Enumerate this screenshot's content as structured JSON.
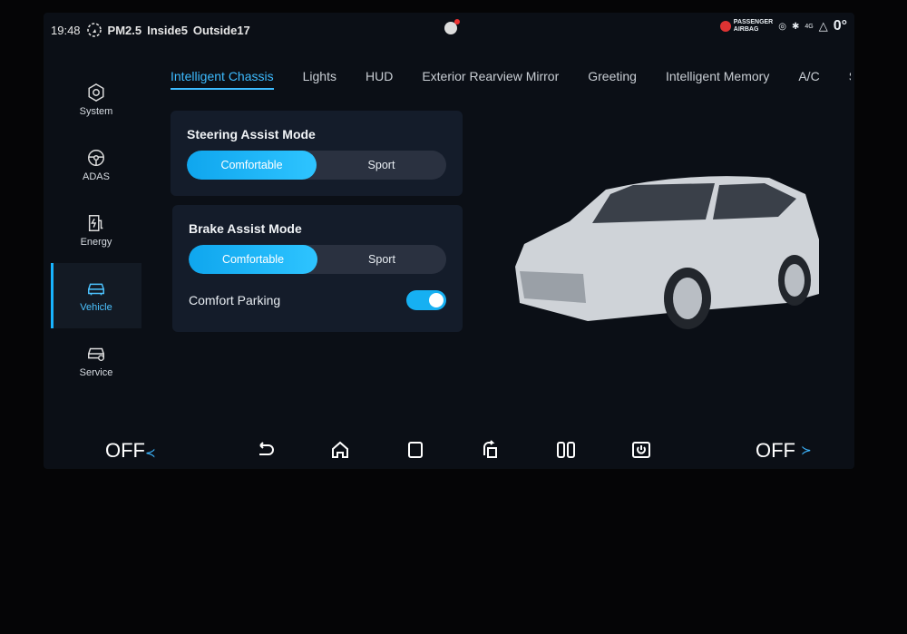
{
  "status": {
    "time": "19:48",
    "pm25": "PM2.5",
    "inside": "Inside5",
    "outside": "Outside17",
    "airbag": [
      "PASSENGER",
      "AIRBAG"
    ],
    "signal": "4G",
    "temperature": "0°"
  },
  "sidebar": {
    "items": [
      {
        "label": "System",
        "icon": "gear-icon"
      },
      {
        "label": "ADAS",
        "icon": "steering-wheel-icon"
      },
      {
        "label": "Energy",
        "icon": "fuel-charge-icon"
      },
      {
        "label": "Vehicle",
        "icon": "car-icon",
        "active": true
      },
      {
        "label": "Service",
        "icon": "car-service-icon"
      }
    ]
  },
  "tabs": [
    "Intelligent Chassis",
    "Lights",
    "HUD",
    "Exterior Rearview Mirror",
    "Greeting",
    "Intelligent Memory",
    "A/C",
    "S"
  ],
  "steering": {
    "title": "Steering Assist Mode",
    "options": [
      "Comfortable",
      "Sport"
    ],
    "selected": "Comfortable"
  },
  "brake": {
    "title": "Brake Assist Mode",
    "options": [
      "Comfortable",
      "Sport"
    ],
    "selected": "Comfortable"
  },
  "comfort_parking": {
    "label": "Comfort Parking",
    "enabled": true
  },
  "bottom": {
    "left_fan": "OFF",
    "right_fan": "OFF",
    "nav_icons": [
      "back-icon",
      "home-icon",
      "recent-apps-icon",
      "rotate-screen-icon",
      "split-screen-icon",
      "screen-off-icon"
    ]
  },
  "colors": {
    "accent": "#18b4ff",
    "background": "#0b0f16",
    "card": "#141c2a"
  }
}
